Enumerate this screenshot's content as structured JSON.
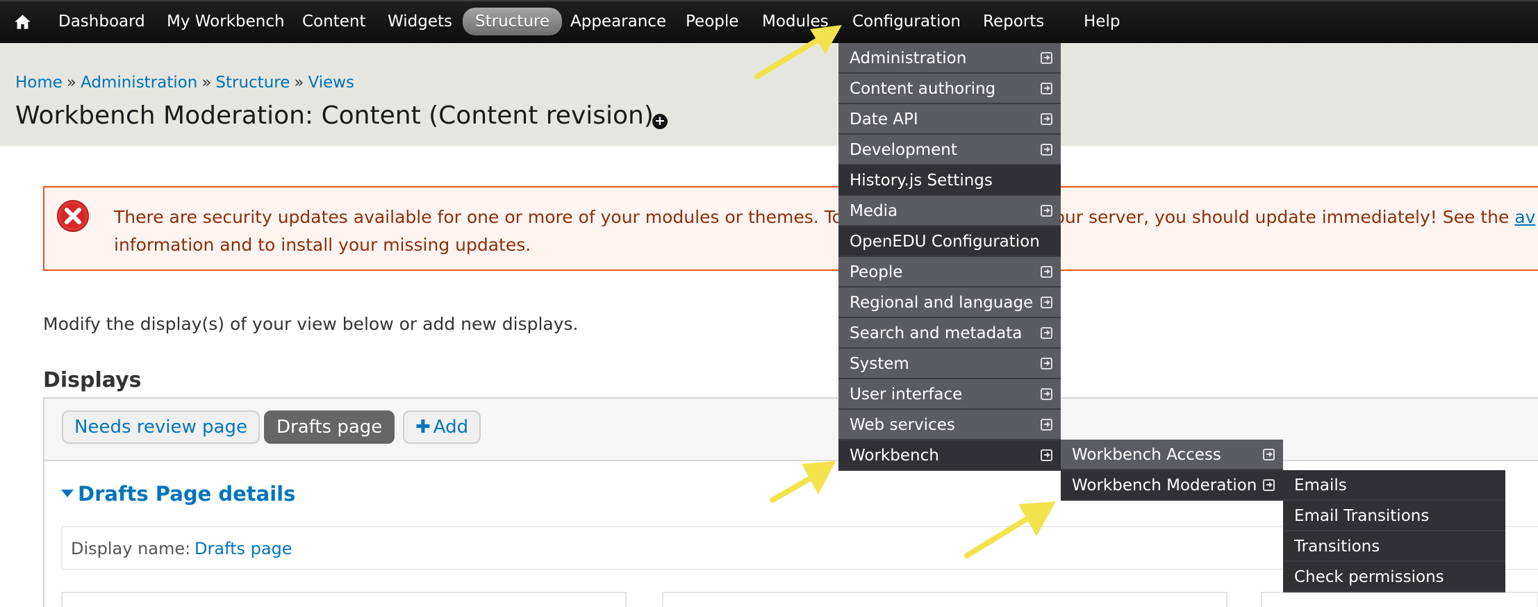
{
  "toolbar": {
    "home_icon": "home-icon",
    "items": [
      {
        "label": "Dashboard"
      },
      {
        "label": "My Workbench"
      },
      {
        "label": "Content"
      },
      {
        "label": "Widgets"
      },
      {
        "label": "Structure",
        "active": true
      },
      {
        "label": "Appearance"
      },
      {
        "label": "People"
      },
      {
        "label": "Modules"
      },
      {
        "label": "Configuration",
        "hover": true
      },
      {
        "label": "Reports"
      },
      {
        "label": "Help"
      }
    ]
  },
  "breadcrumb": {
    "items": [
      "Home",
      "Administration",
      "Structure",
      "Views"
    ],
    "separator": "»"
  },
  "page_title": "Workbench Moderation: Content (Content revision)",
  "error": {
    "icon": "error-x-icon",
    "line1_pre": "There are security updates available for one or more of your modules or themes. To ensure the security of your server, you should update immediately! See the ",
    "line1_link": "av",
    "line2": "information and to install your missing updates."
  },
  "intro": "Modify the display(s) of your view below or add new displays.",
  "displays": {
    "heading": "Displays",
    "tabs": [
      "Needs review page",
      "Drafts page"
    ],
    "add_label": "Add",
    "details_heading": "Drafts Page details",
    "display_name_label": "Display name:",
    "display_name_value": "Drafts page"
  },
  "config_menu": {
    "items": [
      {
        "label": "Administration",
        "submenu": true
      },
      {
        "label": "Content authoring",
        "submenu": true
      },
      {
        "label": "Date API",
        "submenu": true
      },
      {
        "label": "Development",
        "submenu": true
      },
      {
        "label": "History.js Settings",
        "submenu": false
      },
      {
        "label": "Media",
        "submenu": true
      },
      {
        "label": "OpenEDU Configuration",
        "submenu": false
      },
      {
        "label": "People",
        "submenu": true
      },
      {
        "label": "Regional and language",
        "submenu": true
      },
      {
        "label": "Search and metadata",
        "submenu": true
      },
      {
        "label": "System",
        "submenu": true
      },
      {
        "label": "User interface",
        "submenu": true
      },
      {
        "label": "Web services",
        "submenu": true
      },
      {
        "label": "Workbench",
        "submenu": true
      }
    ]
  },
  "workbench_menu": {
    "items": [
      {
        "label": "Workbench Access",
        "submenu": true
      },
      {
        "label": "Workbench Moderation",
        "submenu": true
      }
    ]
  },
  "moderation_menu": {
    "items": [
      {
        "label": "Emails"
      },
      {
        "label": "Email Transitions"
      },
      {
        "label": "Transitions"
      },
      {
        "label": "Check permissions"
      }
    ]
  },
  "colors": {
    "link": "#0072b9",
    "error_border": "#ed541d",
    "error_text": "#8c2e0b",
    "annotation_arrow": "#f2e34c"
  }
}
